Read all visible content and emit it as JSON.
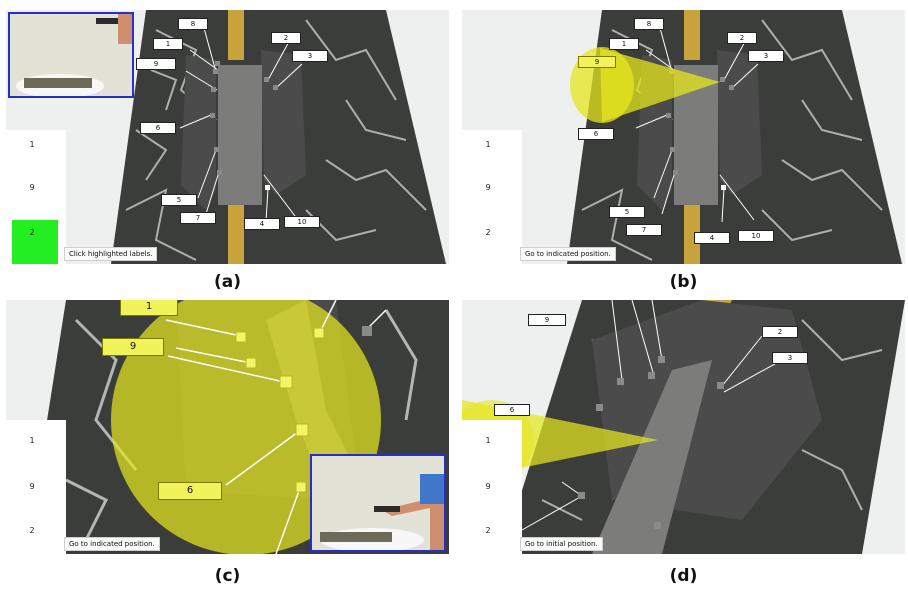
{
  "captions": [
    "(a)",
    "(b)",
    "(c)",
    "(d)"
  ],
  "side_numbers": [
    "1",
    "9",
    "2"
  ],
  "status": {
    "a": "Click highlighted labels.",
    "b": "Go to indicated position.",
    "c": "Go to indicated position.",
    "d": "Go to initial position."
  },
  "labels": {
    "l1": "1",
    "l2": "2",
    "l3": "3",
    "l4": "4",
    "l5": "5",
    "l6": "6",
    "l7": "7",
    "l8": "8",
    "l9": "9",
    "l10": "10"
  },
  "colors": {
    "highlight": "#f2f25a",
    "cone": "#e6e61e",
    "active_slot": "#22ee22",
    "inset_border": "#2430c9"
  }
}
